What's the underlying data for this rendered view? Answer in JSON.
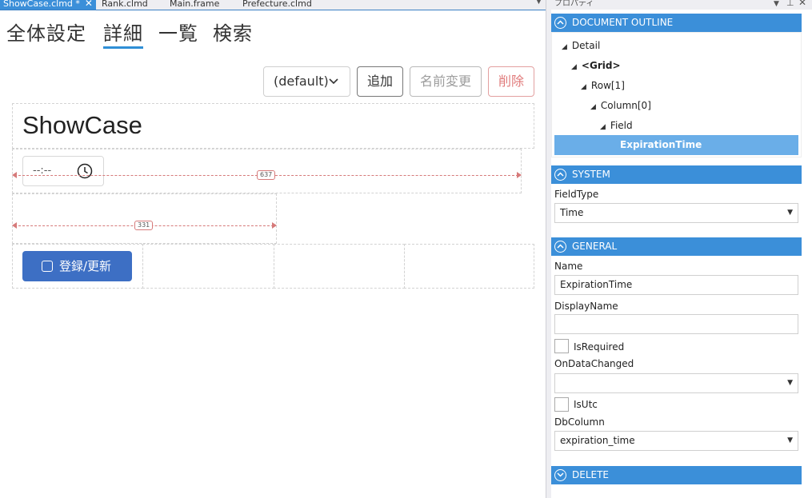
{
  "tabs": [
    {
      "label": "ShowCase.clmd *",
      "active": true
    },
    {
      "label": "Rank.clmd",
      "active": false
    },
    {
      "label": "Main.frame",
      "active": false
    },
    {
      "label": "Prefecture.clmd",
      "active": false
    }
  ],
  "nav": {
    "items": [
      "全体設定",
      "詳細",
      "一覧",
      "検索"
    ],
    "active_index": 1
  },
  "toolbar": {
    "layout_select": "(default)",
    "add_label": "追加",
    "rename_label": "名前変更",
    "delete_label": "削除"
  },
  "form": {
    "title": "ShowCase",
    "time_placeholder": "--:--",
    "measure_row1": "637",
    "measure_row2": "331",
    "submit_label": "登録/更新"
  },
  "properties": {
    "panel_title": "プロパティ",
    "outline_header": "DOCUMENT OUTLINE",
    "outline": [
      {
        "label": "Detail",
        "expandable": true
      },
      {
        "label": "<Grid>",
        "expandable": true
      },
      {
        "label": "Row[1]",
        "expandable": true
      },
      {
        "label": "Column[0]",
        "expandable": true
      },
      {
        "label": "Field",
        "expandable": true
      },
      {
        "label": "ExpirationTime",
        "expandable": false,
        "selected": true
      }
    ],
    "system_header": "SYSTEM",
    "fieldtype_label": "FieldType",
    "fieldtype_value": "Time",
    "general_header": "GENERAL",
    "name_label": "Name",
    "name_value": "ExpirationTime",
    "displayname_label": "DisplayName",
    "displayname_value": "",
    "isrequired_label": "IsRequired",
    "ondatachanged_label": "OnDataChanged",
    "ondatachanged_value": "",
    "isutc_label": "IsUtc",
    "dbcolumn_label": "DbColumn",
    "dbcolumn_value": "expiration_time",
    "delete_header": "DELETE"
  },
  "colors": {
    "accent": "#3b8fd9",
    "primary_button": "#3d6fc4",
    "danger": "#e07a7a",
    "selected_row": "#6aaee8"
  },
  "icons": [
    "close-icon",
    "clock-icon",
    "chevron-down-icon",
    "square-icon",
    "collapse-circle-icon",
    "expand-circle-icon",
    "pin-icon",
    "dropdown-arrow-icon"
  ]
}
